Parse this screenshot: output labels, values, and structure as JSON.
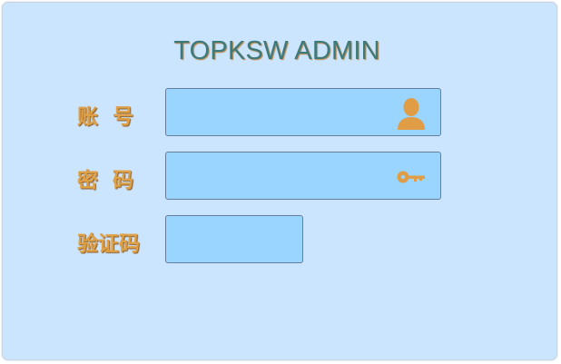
{
  "title": "TOPKSW ADMIN",
  "form": {
    "account": {
      "label": "账  号",
      "value": "",
      "placeholder": "",
      "icon": "user-icon"
    },
    "password": {
      "label": "密  码",
      "value": "",
      "placeholder": "",
      "icon": "key-icon"
    },
    "captcha": {
      "label": "验证码",
      "value": "",
      "placeholder": ""
    }
  },
  "colors": {
    "panel_bg": "#cce5ff",
    "field_bg": "#99d5ff",
    "label": "#e0a146",
    "title": "#3e7a7a",
    "icon": "#e09d45"
  }
}
